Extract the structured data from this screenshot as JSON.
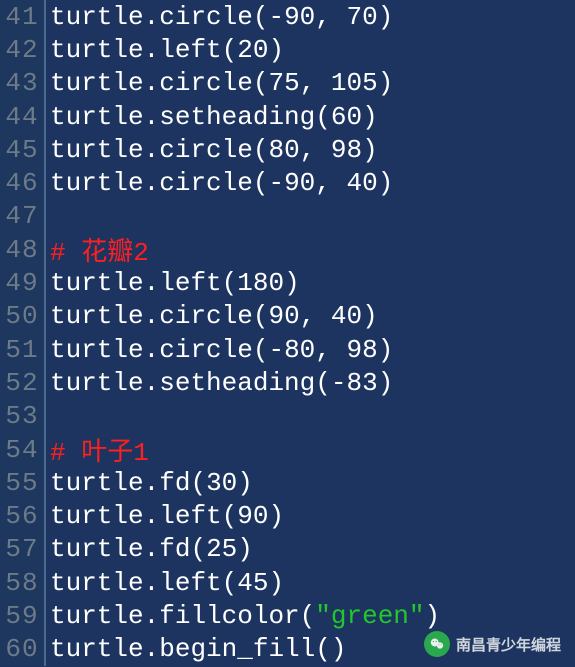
{
  "lines": [
    {
      "n": "41",
      "t": [
        [
          "ident",
          "turtle"
        ],
        [
          "punct",
          "."
        ],
        [
          "ident",
          "circle"
        ],
        [
          "punct",
          "("
        ],
        [
          "num",
          "-90"
        ],
        [
          "punct",
          ", "
        ],
        [
          "num",
          "70"
        ],
        [
          "punct",
          ")"
        ]
      ]
    },
    {
      "n": "42",
      "t": [
        [
          "ident",
          "turtle"
        ],
        [
          "punct",
          "."
        ],
        [
          "ident",
          "left"
        ],
        [
          "punct",
          "("
        ],
        [
          "num",
          "20"
        ],
        [
          "punct",
          ")"
        ]
      ]
    },
    {
      "n": "43",
      "t": [
        [
          "ident",
          "turtle"
        ],
        [
          "punct",
          "."
        ],
        [
          "ident",
          "circle"
        ],
        [
          "punct",
          "("
        ],
        [
          "num",
          "75"
        ],
        [
          "punct",
          ", "
        ],
        [
          "num",
          "105"
        ],
        [
          "punct",
          ")"
        ]
      ]
    },
    {
      "n": "44",
      "t": [
        [
          "ident",
          "turtle"
        ],
        [
          "punct",
          "."
        ],
        [
          "ident",
          "setheading"
        ],
        [
          "punct",
          "("
        ],
        [
          "num",
          "60"
        ],
        [
          "punct",
          ")"
        ]
      ]
    },
    {
      "n": "45",
      "t": [
        [
          "ident",
          "turtle"
        ],
        [
          "punct",
          "."
        ],
        [
          "ident",
          "circle"
        ],
        [
          "punct",
          "("
        ],
        [
          "num",
          "80"
        ],
        [
          "punct",
          ", "
        ],
        [
          "num",
          "98"
        ],
        [
          "punct",
          ")"
        ]
      ]
    },
    {
      "n": "46",
      "t": [
        [
          "ident",
          "turtle"
        ],
        [
          "punct",
          "."
        ],
        [
          "ident",
          "circle"
        ],
        [
          "punct",
          "("
        ],
        [
          "num",
          "-90"
        ],
        [
          "punct",
          ", "
        ],
        [
          "num",
          "40"
        ],
        [
          "punct",
          ")"
        ]
      ]
    },
    {
      "n": "47",
      "t": []
    },
    {
      "n": "48",
      "t": [
        [
          "comment",
          "# 花瓣2"
        ]
      ]
    },
    {
      "n": "49",
      "t": [
        [
          "ident",
          "turtle"
        ],
        [
          "punct",
          "."
        ],
        [
          "ident",
          "left"
        ],
        [
          "punct",
          "("
        ],
        [
          "num",
          "180"
        ],
        [
          "punct",
          ")"
        ]
      ]
    },
    {
      "n": "50",
      "t": [
        [
          "ident",
          "turtle"
        ],
        [
          "punct",
          "."
        ],
        [
          "ident",
          "circle"
        ],
        [
          "punct",
          "("
        ],
        [
          "num",
          "90"
        ],
        [
          "punct",
          ", "
        ],
        [
          "num",
          "40"
        ],
        [
          "punct",
          ")"
        ]
      ]
    },
    {
      "n": "51",
      "t": [
        [
          "ident",
          "turtle"
        ],
        [
          "punct",
          "."
        ],
        [
          "ident",
          "circle"
        ],
        [
          "punct",
          "("
        ],
        [
          "num",
          "-80"
        ],
        [
          "punct",
          ", "
        ],
        [
          "num",
          "98"
        ],
        [
          "punct",
          ")"
        ]
      ]
    },
    {
      "n": "52",
      "t": [
        [
          "ident",
          "turtle"
        ],
        [
          "punct",
          "."
        ],
        [
          "ident",
          "setheading"
        ],
        [
          "punct",
          "("
        ],
        [
          "num",
          "-83"
        ],
        [
          "punct",
          ")"
        ]
      ]
    },
    {
      "n": "53",
      "t": []
    },
    {
      "n": "54",
      "t": [
        [
          "comment",
          "# 叶子1"
        ]
      ]
    },
    {
      "n": "55",
      "t": [
        [
          "ident",
          "turtle"
        ],
        [
          "punct",
          "."
        ],
        [
          "ident",
          "fd"
        ],
        [
          "punct",
          "("
        ],
        [
          "num",
          "30"
        ],
        [
          "punct",
          ")"
        ]
      ]
    },
    {
      "n": "56",
      "t": [
        [
          "ident",
          "turtle"
        ],
        [
          "punct",
          "."
        ],
        [
          "ident",
          "left"
        ],
        [
          "punct",
          "("
        ],
        [
          "num",
          "90"
        ],
        [
          "punct",
          ")"
        ]
      ]
    },
    {
      "n": "57",
      "t": [
        [
          "ident",
          "turtle"
        ],
        [
          "punct",
          "."
        ],
        [
          "ident",
          "fd"
        ],
        [
          "punct",
          "("
        ],
        [
          "num",
          "25"
        ],
        [
          "punct",
          ")"
        ]
      ]
    },
    {
      "n": "58",
      "t": [
        [
          "ident",
          "turtle"
        ],
        [
          "punct",
          "."
        ],
        [
          "ident",
          "left"
        ],
        [
          "punct",
          "("
        ],
        [
          "num",
          "45"
        ],
        [
          "punct",
          ")"
        ]
      ]
    },
    {
      "n": "59",
      "t": [
        [
          "ident",
          "turtle"
        ],
        [
          "punct",
          "."
        ],
        [
          "ident",
          "fillcolor"
        ],
        [
          "punct",
          "("
        ],
        [
          "str",
          "\"green\""
        ],
        [
          "punct",
          ")"
        ]
      ]
    },
    {
      "n": "60",
      "t": [
        [
          "ident",
          "turtle"
        ],
        [
          "punct",
          "."
        ],
        [
          "ident",
          "begin_fill"
        ],
        [
          "punct",
          "()"
        ]
      ]
    }
  ],
  "watermark": {
    "text": "南昌青少年编程"
  }
}
